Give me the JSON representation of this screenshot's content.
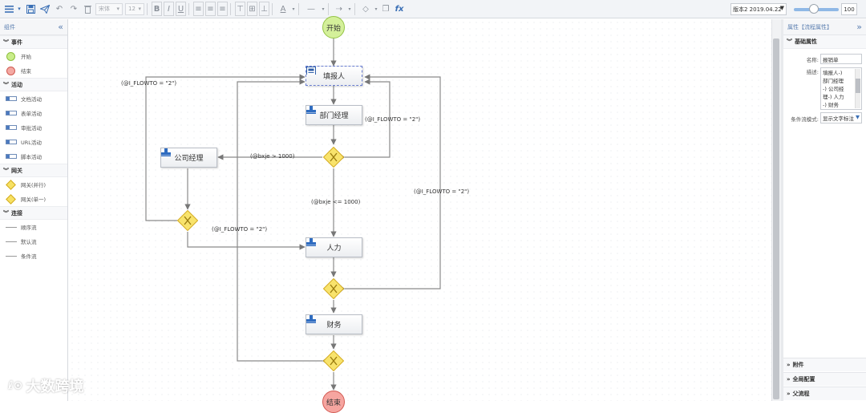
{
  "toolbar": {
    "font_family": "宋体",
    "font_size": "12",
    "bold": "B",
    "italic": "I",
    "underline": "U",
    "fx": "fx",
    "version": "版本2 2019.04.22",
    "zoom": "100",
    "zoom_level": 0.5
  },
  "left_panel": {
    "title": "组件",
    "collapse_icon": "«",
    "sections": [
      {
        "title": "事件",
        "items": [
          {
            "label": "开始",
            "icon": "start-event-icon"
          },
          {
            "label": "结束",
            "icon": "end-event-icon"
          }
        ]
      },
      {
        "title": "活动",
        "items": [
          {
            "label": "文档活动",
            "icon": "activity-icon"
          },
          {
            "label": "表单活动",
            "icon": "activity-icon"
          },
          {
            "label": "审批活动",
            "icon": "activity-icon"
          },
          {
            "label": "URL活动",
            "icon": "activity-icon"
          },
          {
            "label": "脚本活动",
            "icon": "activity-icon"
          }
        ]
      },
      {
        "title": "网关",
        "items": [
          {
            "label": "网关(并行)",
            "icon": "gateway-icon"
          },
          {
            "label": "网关(单一)",
            "icon": "gateway-icon"
          }
        ]
      },
      {
        "title": "连接",
        "items": [
          {
            "label": "顺序流",
            "icon": "line-icon"
          },
          {
            "label": "默认流",
            "icon": "line-icon"
          },
          {
            "label": "条件流",
            "icon": "line-icon"
          }
        ]
      }
    ]
  },
  "diagram": {
    "start_label": "开始",
    "end_label": "结束",
    "nodes": {
      "applicant": "填报人",
      "dept_manager": "部门经理",
      "company_manager": "公司经理",
      "hr": "人力",
      "finance": "财务"
    },
    "conditions": {
      "flow_left": "(@I_FLOWTO = \"2\")",
      "flow_mid": "(@I_FLOWTO = \"2\")",
      "flow_bottom": "(@I_FLOWTO = \"2\")",
      "flow_right": "(@I_FLOWTO = \"2\")",
      "bxje_gt": "(@bxje > 1000)",
      "bxje_le": "(@bxje <= 1000)"
    }
  },
  "right_panel": {
    "title": "属性【流程属性】",
    "expand_icon": "»",
    "basic_section": "基础属性",
    "name_label": "名称:",
    "name_value": "报销单",
    "desc_label": "描述:",
    "desc_lines": [
      "填报人-)",
      "部门经理",
      "-) 公司经",
      "理-) 人力",
      "-) 财务"
    ],
    "cond_label": "条件流模式:",
    "cond_value": "显示文字标注",
    "bottom_sections": [
      "附件",
      "全局配置",
      "父流程"
    ]
  },
  "watermark": {
    "logo": "ℓ⊙",
    "text": "大数跨境"
  }
}
